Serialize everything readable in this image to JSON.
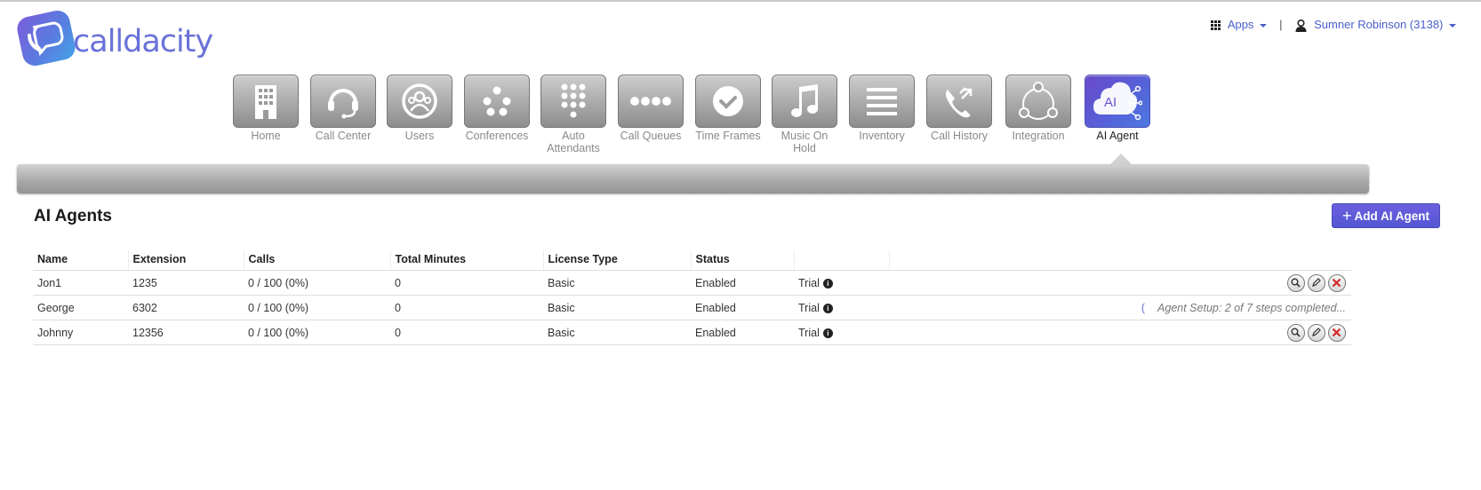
{
  "brand": {
    "name": "calldacity"
  },
  "topbar": {
    "apps_label": "Apps",
    "separator": "|",
    "user_label": "Sumner Robinson (3138)"
  },
  "nav": [
    {
      "label": "Home",
      "icon": "building-icon"
    },
    {
      "label": "Call Center",
      "icon": "headset-icon"
    },
    {
      "label": "Users",
      "icon": "users-icon"
    },
    {
      "label": "Conferences",
      "icon": "conference-icon"
    },
    {
      "label": "Auto Attendants",
      "icon": "keypad-icon"
    },
    {
      "label": "Call Queues",
      "icon": "queue-dots-icon"
    },
    {
      "label": "Time Frames",
      "icon": "clock-icon"
    },
    {
      "label": "Music On Hold",
      "icon": "music-note-icon"
    },
    {
      "label": "Inventory",
      "icon": "list-lines-icon"
    },
    {
      "label": "Call History",
      "icon": "phone-arrows-icon"
    },
    {
      "label": "Integration",
      "icon": "integration-circle-icon"
    },
    {
      "label": "AI Agent",
      "icon": "ai-agent-icon",
      "active": true
    }
  ],
  "page": {
    "title": "AI Agents",
    "add_button": "Add AI Agent",
    "add_icon": "+"
  },
  "table": {
    "columns": [
      "Name",
      "Extension",
      "Calls",
      "Total Minutes",
      "License Type",
      "Status",
      "",
      ""
    ],
    "rows": [
      {
        "name": "Jon1",
        "extension": "1235",
        "calls": "0 / 100 (0%)",
        "minutes": "0",
        "license": "Basic",
        "status": "Enabled",
        "plan": "Trial",
        "note": ""
      },
      {
        "name": "George",
        "extension": "6302",
        "calls": "0 / 100 (0%)",
        "minutes": "0",
        "license": "Basic",
        "status": "Enabled",
        "plan": "Trial",
        "note": "Agent Setup: 2 of 7 steps completed..."
      },
      {
        "name": "Johnny",
        "extension": "12356",
        "calls": "0 / 100 (0%)",
        "minutes": "0",
        "license": "Basic",
        "status": "Enabled",
        "plan": "Trial",
        "note": ""
      }
    ]
  },
  "icons": {
    "info": "i",
    "spinner": "(",
    "action_icons": [
      "view-icon",
      "edit-icon",
      "delete-icon"
    ]
  },
  "colors": {
    "accent": "#5a5fd6",
    "link": "#4a5fc9",
    "delete": "#d22a2a"
  }
}
